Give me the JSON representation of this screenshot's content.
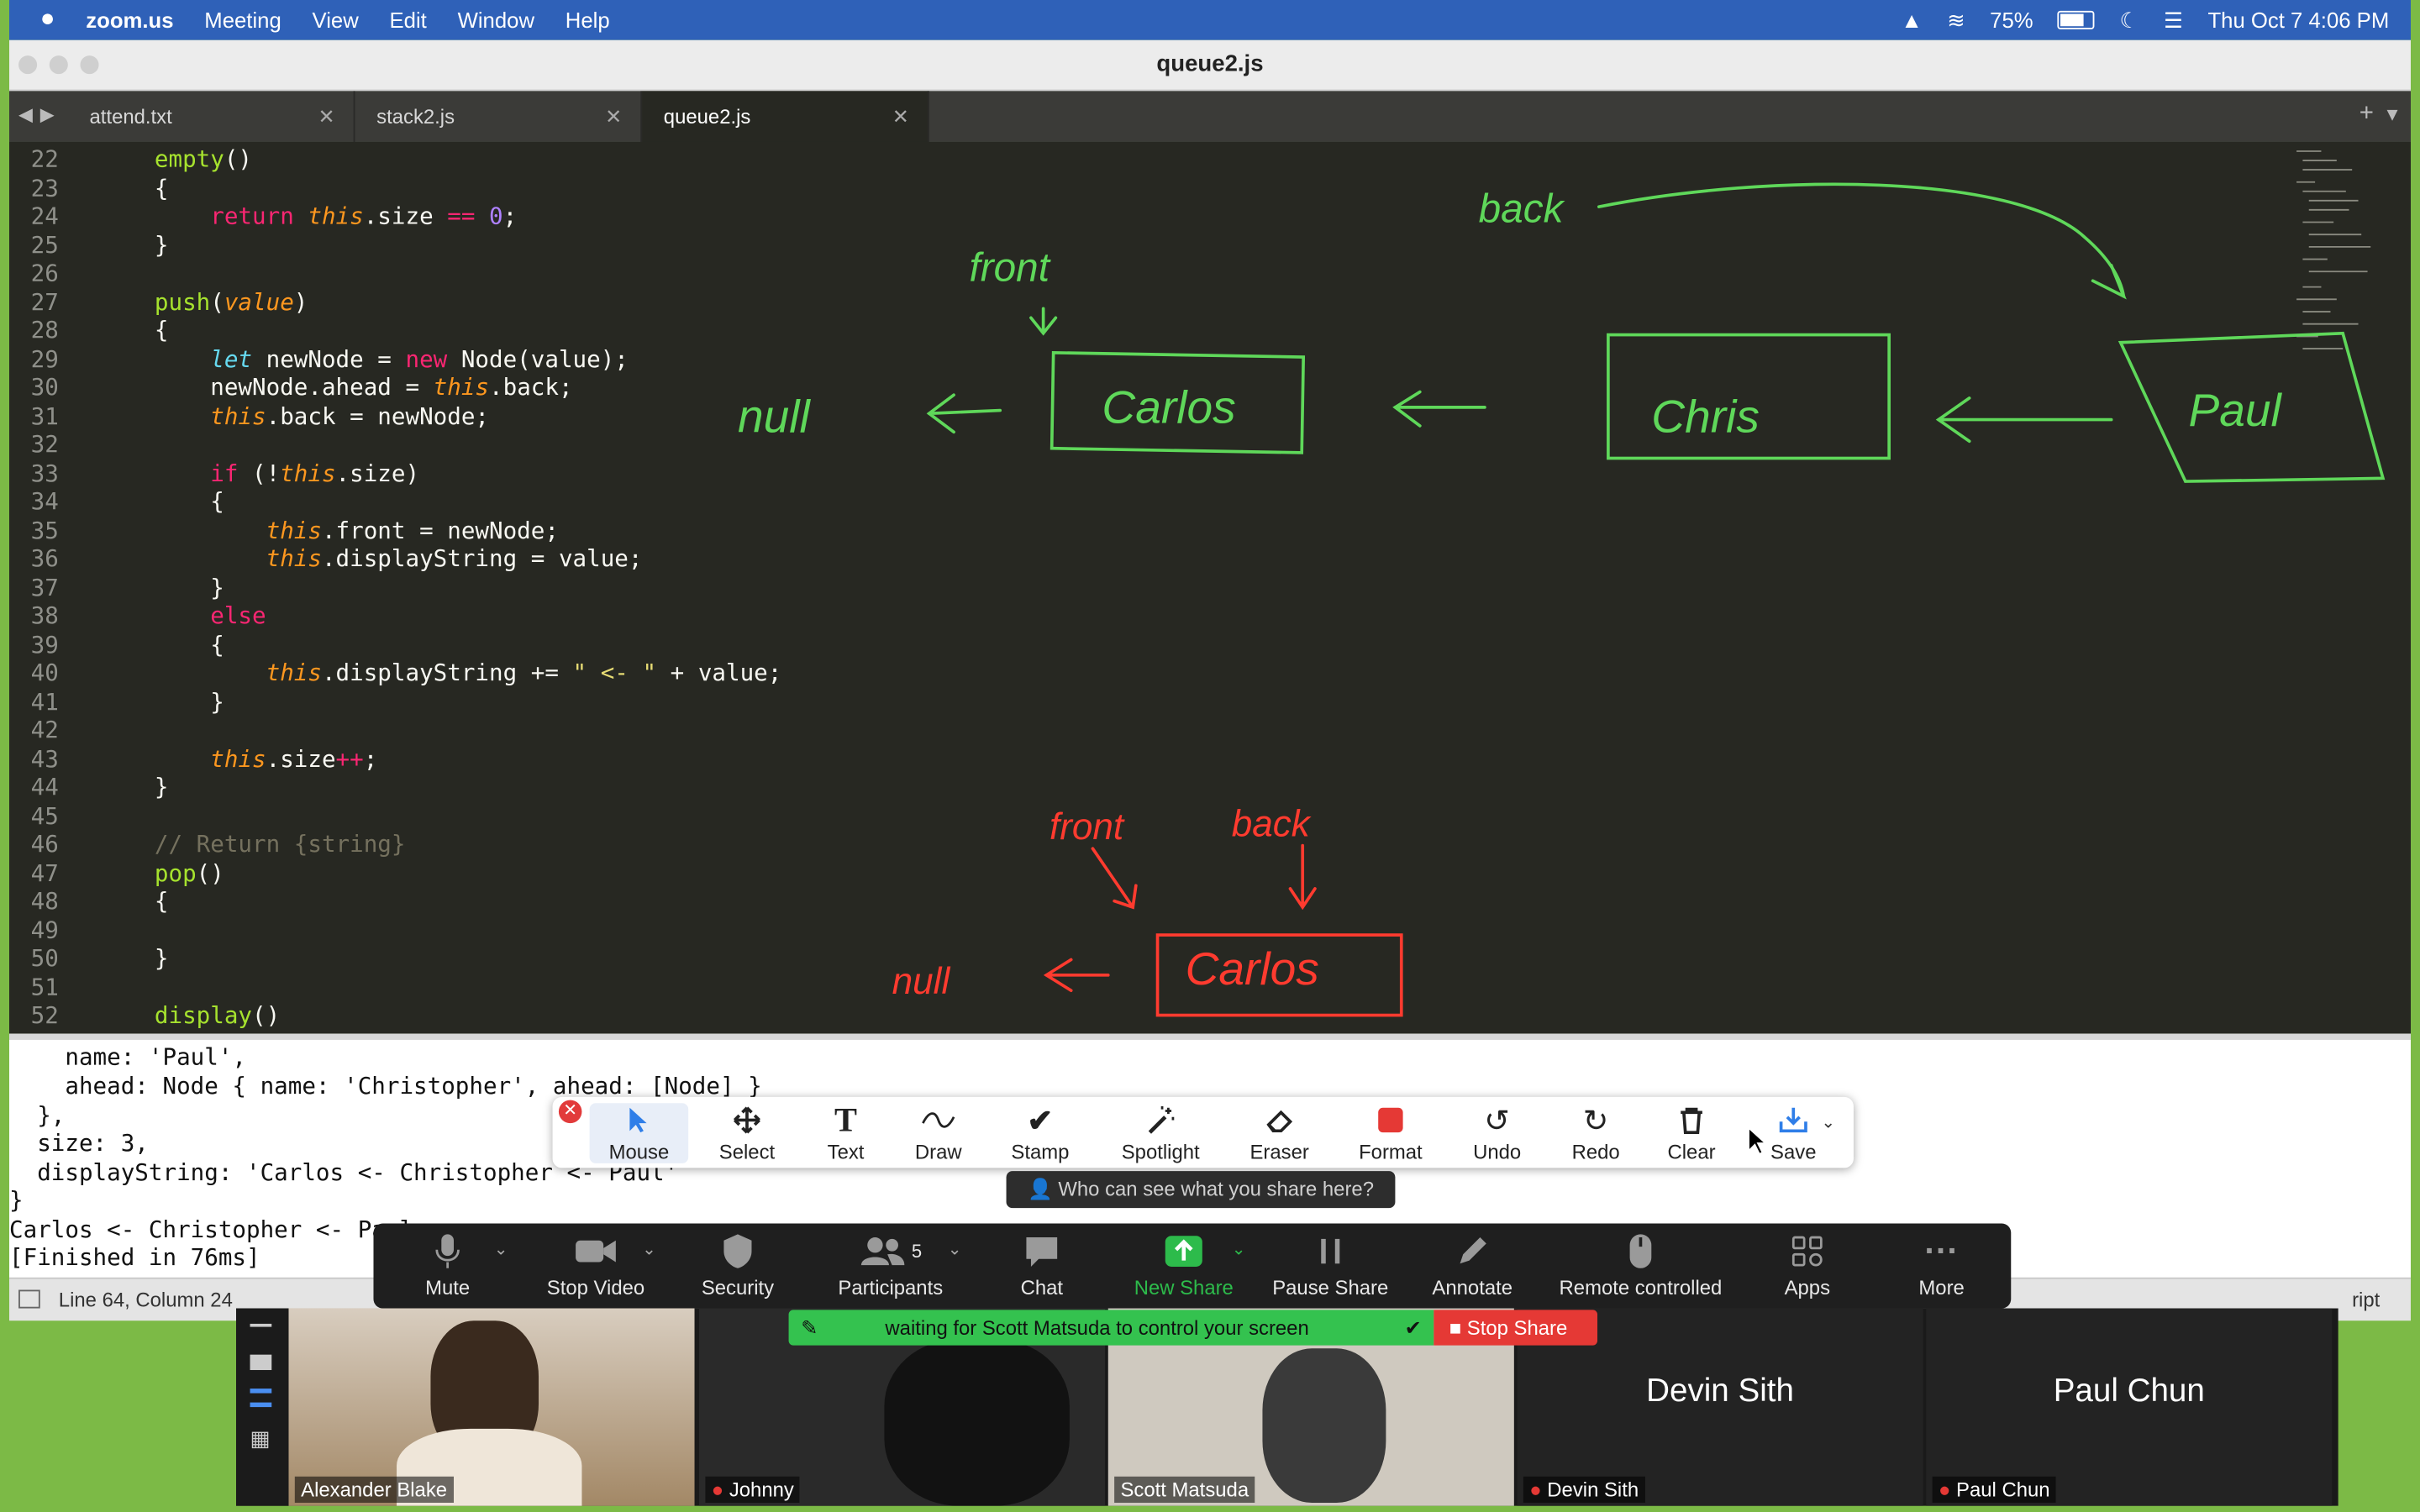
{
  "menubar": {
    "app": "zoom.us",
    "items": [
      "Meeting",
      "View",
      "Edit",
      "Window",
      "Help"
    ],
    "battery": "75%",
    "clock": "Thu Oct 7  4:06 PM"
  },
  "window": {
    "title": "queue2.js"
  },
  "tabs": [
    {
      "label": "attend.txt"
    },
    {
      "label": "stack2.js"
    },
    {
      "label": "queue2.js"
    }
  ],
  "code_lines": [
    {
      "n": "22",
      "t": "    empty()"
    },
    {
      "n": "23",
      "t": "    {"
    },
    {
      "n": "24",
      "t": "        return this.size == 0;"
    },
    {
      "n": "25",
      "t": "    }"
    },
    {
      "n": "26",
      "t": ""
    },
    {
      "n": "27",
      "t": "    push(value)"
    },
    {
      "n": "28",
      "t": "    {"
    },
    {
      "n": "29",
      "t": "        let newNode = new Node(value);"
    },
    {
      "n": "30",
      "t": "        newNode.ahead = this.back;"
    },
    {
      "n": "31",
      "t": "        this.back = newNode;"
    },
    {
      "n": "32",
      "t": ""
    },
    {
      "n": "33",
      "t": "        if (!this.size)"
    },
    {
      "n": "34",
      "t": "        {"
    },
    {
      "n": "35",
      "t": "            this.front = newNode;"
    },
    {
      "n": "36",
      "t": "            this.displayString = value;"
    },
    {
      "n": "37",
      "t": "        }"
    },
    {
      "n": "38",
      "t": "        else"
    },
    {
      "n": "39",
      "t": "        {"
    },
    {
      "n": "40",
      "t": "            this.displayString += \" <- \" + value;"
    },
    {
      "n": "41",
      "t": "        }"
    },
    {
      "n": "42",
      "t": ""
    },
    {
      "n": "43",
      "t": "        this.size++;"
    },
    {
      "n": "44",
      "t": "    }"
    },
    {
      "n": "45",
      "t": ""
    },
    {
      "n": "46",
      "t": "    // Return {string}"
    },
    {
      "n": "47",
      "t": "    pop()"
    },
    {
      "n": "48",
      "t": "    {"
    },
    {
      "n": "49",
      "t": ""
    },
    {
      "n": "50",
      "t": "    }"
    },
    {
      "n": "51",
      "t": ""
    },
    {
      "n": "52",
      "t": "    display()"
    }
  ],
  "drawing": {
    "green_labels": [
      "back",
      "front",
      "null",
      "Carlos",
      "Chris",
      "Paul"
    ],
    "red_labels": [
      "front",
      "back",
      "null",
      "Carlos"
    ]
  },
  "console_lines": [
    "    name: 'Paul',",
    "    ahead: Node { name: 'Christopher', ahead: [Node] }",
    "  },",
    "  size: 3,",
    "  displayString: 'Carlos <- Christopher <- Paul'",
    "}",
    "Carlos <- Christopher <- Paul",
    "[Finished in 76ms]"
  ],
  "statusbar": {
    "position": "Line 64, Column 24",
    "syntax": "ript"
  },
  "annotate_toolbar": {
    "tools": [
      "Mouse",
      "Select",
      "Text",
      "Draw",
      "Stamp",
      "Spotlight",
      "Eraser",
      "Format",
      "Undo",
      "Redo",
      "Clear",
      "Save"
    ]
  },
  "share_notice": "Who can see what you share here?",
  "zoom_controls": {
    "buttons": [
      "Mute",
      "Stop Video",
      "Security",
      "Participants",
      "Chat",
      "New Share",
      "Pause Share",
      "Annotate",
      "Remote controlled",
      "Apps",
      "More"
    ],
    "participants_count": "5"
  },
  "remote_control": {
    "message": "waiting for Scott Matsuda to control your screen",
    "stop_label": "Stop Share"
  },
  "participants": [
    {
      "name": "Alexander Blake",
      "video": true
    },
    {
      "name": "Johnny",
      "video": true
    },
    {
      "name": "Scott Matsuda",
      "video": true
    },
    {
      "name": "Devin Sith",
      "video": false
    },
    {
      "name": "Paul Chun",
      "video": false
    }
  ],
  "colors": {
    "zoom_blue": "#2f61b8",
    "editor_bg": "#272822",
    "green_ink": "#5fd85a",
    "red_ink": "#ff3b2f",
    "new_share": "#2dbb4b",
    "stop_share": "#e53935"
  }
}
